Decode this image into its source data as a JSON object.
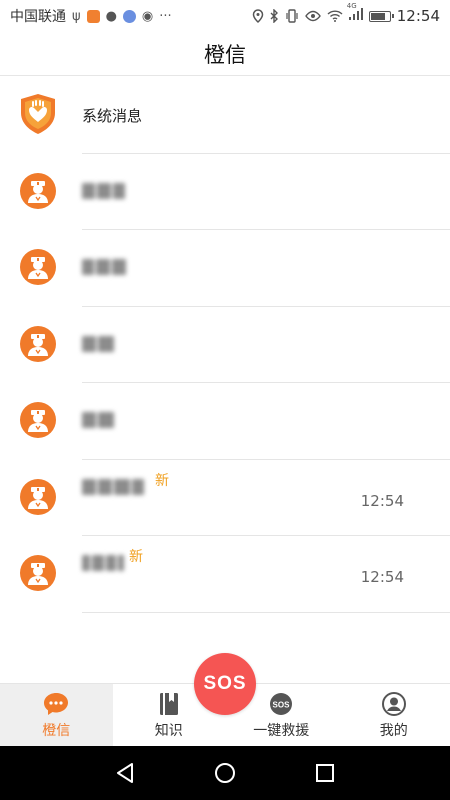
{
  "status_bar": {
    "carrier": "中国联通",
    "network": "4G",
    "time": "12:54",
    "battery_level": 0.85,
    "left_icons": [
      "usb-icon",
      "app-badge-icon",
      "chat-bubble-icon",
      "music-icon",
      "wechat-icon",
      "more-icon"
    ],
    "right_icons": [
      "location-icon",
      "bluetooth-icon",
      "vibrate-icon",
      "eye-icon",
      "wifi-icon",
      "signal-icon",
      "battery-icon"
    ]
  },
  "header": {
    "title": "橙信"
  },
  "messages": [
    {
      "type": "system",
      "name": "系统消息",
      "icon": "shield-hands-icon",
      "new_label": "",
      "time": ""
    },
    {
      "type": "nurse",
      "name": "",
      "icon": "nurse-avatar-icon",
      "new_label": "",
      "time": ""
    },
    {
      "type": "nurse",
      "name": "",
      "icon": "nurse-avatar-icon",
      "new_label": "",
      "time": ""
    },
    {
      "type": "nurse",
      "name": "",
      "icon": "nurse-avatar-icon",
      "new_label": "",
      "time": ""
    },
    {
      "type": "nurse",
      "name": "",
      "icon": "nurse-avatar-icon",
      "new_label": "",
      "time": ""
    },
    {
      "type": "nurse",
      "name": "",
      "icon": "nurse-avatar-icon",
      "new_label": "新",
      "time": "12:54"
    },
    {
      "type": "nurse",
      "name": "",
      "icon": "nurse-avatar-icon",
      "new_label": "新",
      "time": "12:54"
    }
  ],
  "bottom_nav": {
    "items": [
      {
        "label": "橙信",
        "icon": "chat-icon",
        "active": true
      },
      {
        "label": "知识",
        "icon": "book-icon",
        "active": false
      },
      {
        "label": "一键救援",
        "icon": "sos-icon",
        "active": false
      },
      {
        "label": "我的",
        "icon": "user-icon",
        "active": false
      }
    ],
    "sos_label": "SOS",
    "small_sos_label": "SOS"
  },
  "colors": {
    "accent": "#f07a2a",
    "new_badge": "#f0a020",
    "sos": "#f55553"
  }
}
